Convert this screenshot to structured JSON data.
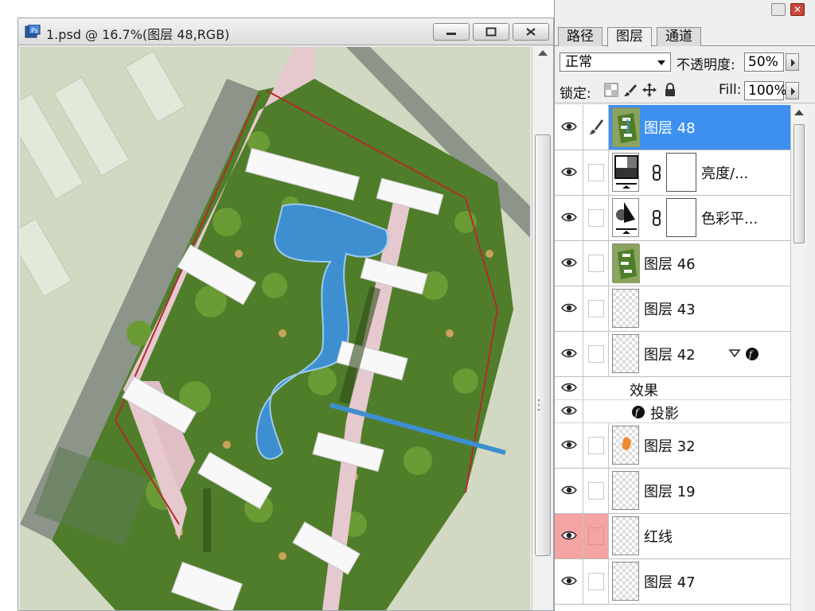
{
  "document": {
    "title": "1.psd @ 16.7%(图层 48,RGB)"
  },
  "panel": {
    "tabs": [
      {
        "label": "路径"
      },
      {
        "label": "图层"
      },
      {
        "label": "通道"
      }
    ],
    "menu_glyph": "»",
    "blend_mode": "正常",
    "opacity_label": "不透明度:",
    "opacity_value": "50%",
    "lock_label": "锁定:",
    "fill_label": "Fill:",
    "fill_value": "100%",
    "layers": [
      {
        "name": "图层 48",
        "selected": true,
        "visible": true,
        "thumb": "site-plan"
      },
      {
        "name": "亮度/...",
        "visible": true,
        "thumb": "brightness-adjust"
      },
      {
        "name": "色彩平...",
        "visible": true,
        "thumb": "color-balance-adjust"
      },
      {
        "name": "图层 46",
        "visible": true,
        "thumb": "site-plan"
      },
      {
        "name": "图层 43",
        "visible": true,
        "thumb": "transparent"
      },
      {
        "name": "图层 42",
        "visible": true,
        "thumb": "transparent",
        "has_effects": true
      },
      {
        "name": "图层 32",
        "visible": true,
        "thumb": "orange-shape"
      },
      {
        "name": "图层 19",
        "visible": true,
        "thumb": "transparent"
      },
      {
        "name": "红线",
        "visible": true,
        "thumb": "transparent",
        "highlight_color": "#f5a3a3"
      },
      {
        "name": "图层 47",
        "visible": true,
        "thumb": "transparent"
      }
    ],
    "effects": {
      "group_label": "效果",
      "items": [
        {
          "label": "投影"
        }
      ]
    }
  },
  "colors": {
    "selection": "#3d90ef",
    "red_label": "#f5a3a3"
  }
}
